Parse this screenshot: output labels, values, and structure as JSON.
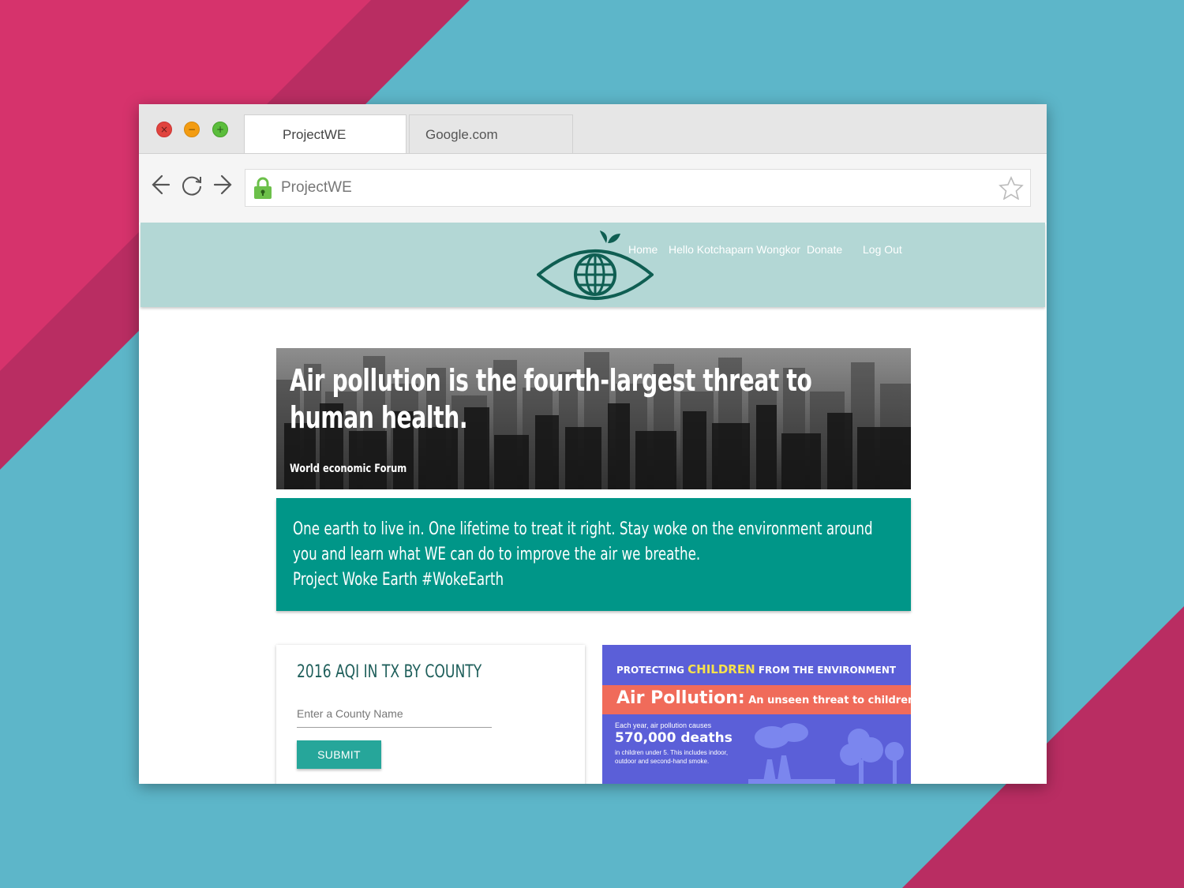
{
  "colors": {
    "bg_blue": "#5db6c9",
    "bg_pink": "#d6336c",
    "header_teal": "#b3d7d5",
    "banner_teal": "#009688",
    "button_teal": "#26a69a",
    "infographic_purple": "#5b5fd8",
    "infographic_coral": "#f06b5a"
  },
  "browser": {
    "tabs": [
      {
        "label": "ProjectWE",
        "active": true
      },
      {
        "label": "Google.com",
        "active": false
      }
    ],
    "window_controls": [
      "close-icon",
      "minimize-icon",
      "maximize-icon"
    ],
    "nav_icons": [
      "back-arrow-icon",
      "reload-icon",
      "forward-arrow-icon"
    ],
    "address": "ProjectWE",
    "bookmark_icon": "star-icon",
    "secure_icon": "lock-icon"
  },
  "site": {
    "logo": "eye-globe-leaf-logo",
    "nav": {
      "home": "Home",
      "greeting": "Hello Kotchaparn Wongkor",
      "donate": "Donate",
      "logout": "Log Out"
    },
    "hero": {
      "title": "Air pollution is the fourth-largest threat to human health.",
      "source": "World economic Forum"
    },
    "banner": {
      "line1": " One earth to live in. One lifetime to treat it right. Stay woke on the environment around you and learn what WE can do to improve the air we breathe.",
      "line2": "Project Woke Earth #WokeEarth"
    },
    "aqi_card": {
      "title": "2016 AQI IN TX BY COUNTY",
      "input_placeholder": "Enter a County Name",
      "input_value": "",
      "submit_label": "SUBMIT"
    },
    "infographic": {
      "top_pre": "PROTECTING ",
      "top_highlight": "CHILDREN",
      "top_post": " FROM THE ENVIRONMENT",
      "headline": "Air Pollution:",
      "headline_sub": " An unseen threat to children's health.",
      "stat_intro": "Each year, air pollution causes",
      "stat_value": "570,000 deaths",
      "stat_detail": "in children under 5. This includes indoor, outdoor and second-hand smoke."
    }
  }
}
